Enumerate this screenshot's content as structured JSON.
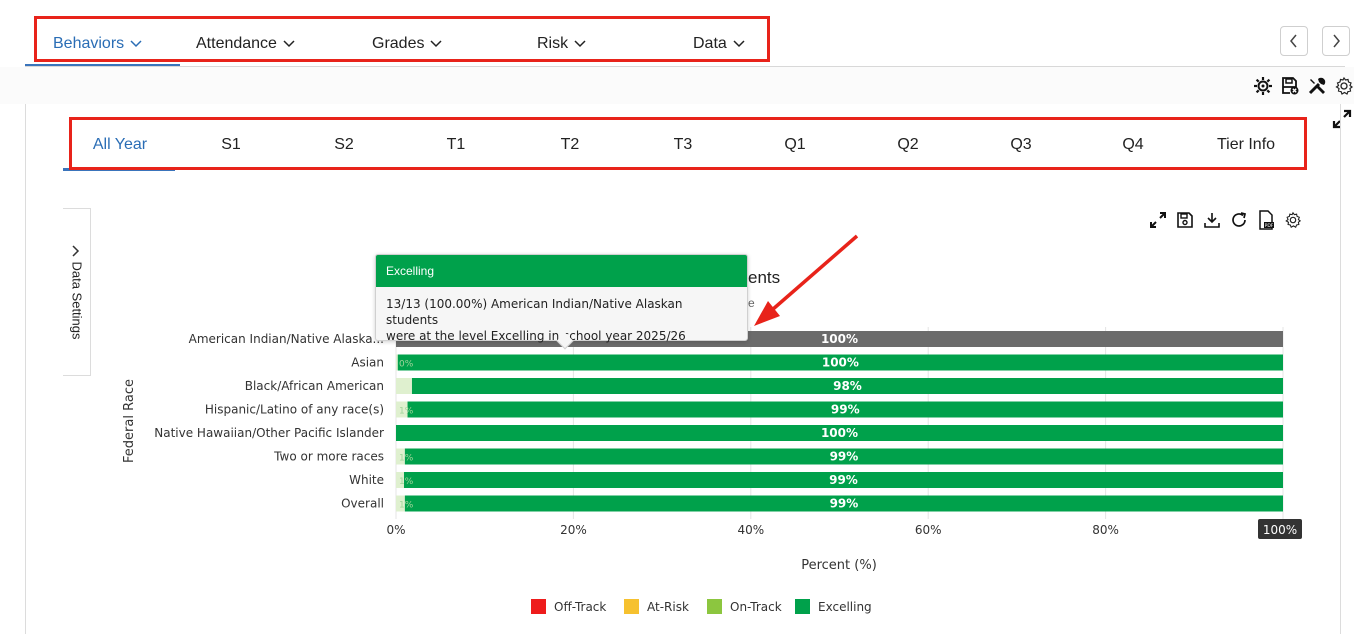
{
  "top_nav": {
    "items": [
      {
        "label": "Behaviors",
        "active": true
      },
      {
        "label": "Attendance",
        "active": false
      },
      {
        "label": "Grades",
        "active": false
      },
      {
        "label": "Risk",
        "active": false
      },
      {
        "label": "Data",
        "active": false
      }
    ],
    "prev_icon": "chevron-left-icon",
    "next_icon": "chevron-right-icon"
  },
  "toolbar": {
    "icons": [
      "gear-sun-icon",
      "save-settings-icon",
      "tools-icon",
      "settings-icon",
      "expand-icon"
    ]
  },
  "period_tabs": [
    {
      "label": "All Year",
      "active": true
    },
    {
      "label": "S1"
    },
    {
      "label": "S2"
    },
    {
      "label": "T1"
    },
    {
      "label": "T2"
    },
    {
      "label": "T3"
    },
    {
      "label": "Q1"
    },
    {
      "label": "Q2"
    },
    {
      "label": "Q3"
    },
    {
      "label": "Q4"
    },
    {
      "label": "Tier Info"
    }
  ],
  "data_settings": {
    "label": "Data Settings",
    "icon": "chevron-right-icon"
  },
  "chart_icons": [
    "expand-icon",
    "save-icon",
    "download-icon",
    "refresh-icon",
    "pdf-icon",
    "settings-icon"
  ],
  "tooltip": {
    "title": "Excelling",
    "line1": "13/13 (100.00%) American Indian/Native Alaskan students",
    "line2": "were at the level Excelling in school year 2025/26"
  },
  "chart_title_fragment": "ents",
  "chart_subtitle_fragment": "e",
  "colors": {
    "accent": "#2a6db5",
    "excelling": "#00a14b",
    "on_track": "#8cc63f",
    "at_risk": "#f6c12f",
    "off_track": "#ee1c1c",
    "highlight_bar": "#6b6b6b",
    "annotation_red": "#e8231a"
  },
  "chart_data": {
    "type": "bar",
    "orientation": "horizontal",
    "stacked": true,
    "title": "",
    "xlabel": "Percent (%)",
    "ylabel": "Federal Race",
    "xlim": [
      0,
      100
    ],
    "x_ticks": [
      "0%",
      "20%",
      "40%",
      "60%",
      "80%",
      "100%"
    ],
    "categories": [
      "American Indian/Native Alaska...",
      "Asian",
      "Black/African American",
      "Hispanic/Latino of any race(s)",
      "Native Hawaiian/Other Pacific Islander",
      "Two or more races",
      "White",
      "Overall"
    ],
    "series": [
      {
        "name": "Off-Track",
        "color": "#ee1c1c",
        "values": [
          0,
          0,
          0,
          0,
          0,
          0,
          0,
          0
        ]
      },
      {
        "name": "At-Risk",
        "color": "#f6c12f",
        "values": [
          0,
          0,
          0,
          0,
          0,
          0,
          0,
          0
        ]
      },
      {
        "name": "On-Track",
        "color": "#8cc63f",
        "values": [
          0,
          0.2,
          1.8,
          1.3,
          0,
          1.0,
          0.9,
          1.0
        ]
      },
      {
        "name": "Excelling",
        "color": "#00a14b",
        "values": [
          100,
          99.8,
          98.2,
          98.7,
          100,
          99.0,
          99.1,
          99.0
        ]
      }
    ],
    "excelling_labels": [
      "100%",
      "100%",
      "98%",
      "99%",
      "100%",
      "99%",
      "99%",
      "99%"
    ],
    "on_track_labels": [
      "",
      "0%",
      "",
      "1%",
      "",
      "1%",
      "1%",
      "1%"
    ],
    "highlighted_category_index": 0,
    "legend_position": "bottom",
    "grid": true
  }
}
